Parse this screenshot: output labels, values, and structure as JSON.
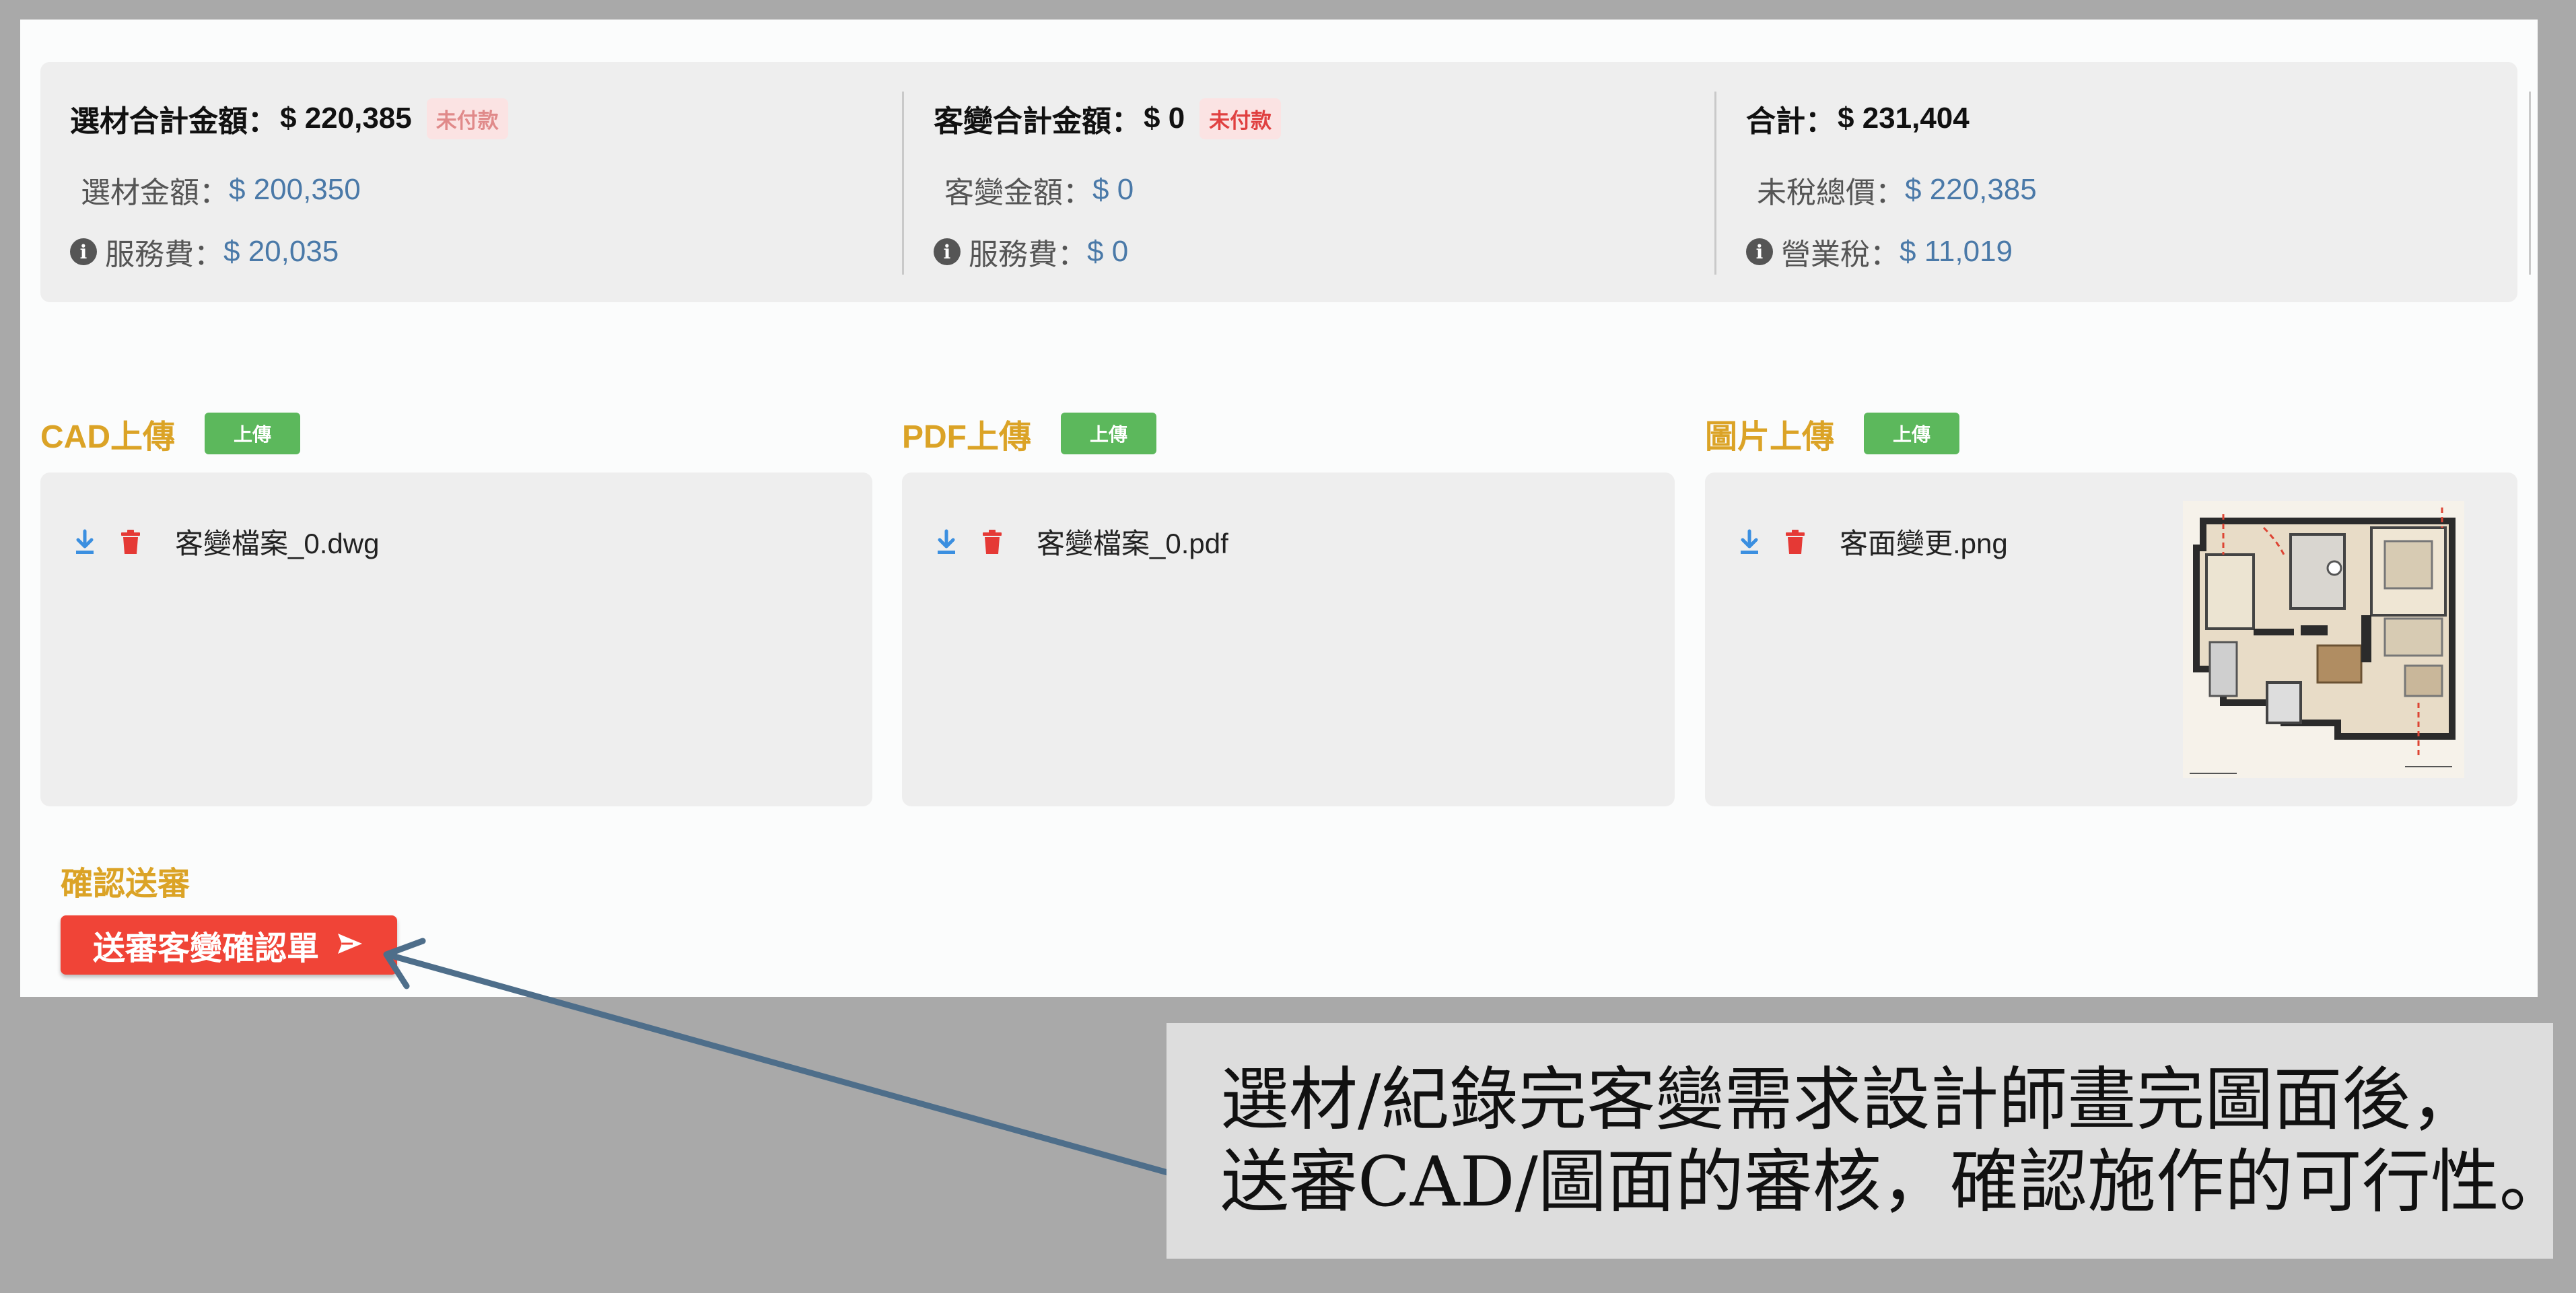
{
  "summary": {
    "materials": {
      "title": "選材合計金額：",
      "total": "$ 220,385",
      "badge": "未付款",
      "row1_label": "選材金額：",
      "row1_value": "$ 200,350",
      "row2_label": "服務費：",
      "row2_value": "$ 20,035"
    },
    "changes": {
      "title": "客變合計金額：",
      "total": "$ 0",
      "badge": "未付款",
      "row1_label": "客變金額：",
      "row1_value": "$ 0",
      "row2_label": "服務費：",
      "row2_value": "$ 0"
    },
    "grand": {
      "title": "合計：",
      "total": "$ 231,404",
      "row1_label": "未稅總價：",
      "row1_value": "$ 220,385",
      "row2_label": "營業稅：",
      "row2_value": "$ 11,019"
    }
  },
  "uploads": {
    "cad": {
      "title": "CAD上傳",
      "button": "上傳",
      "file": "客變檔案_0.dwg"
    },
    "pdf": {
      "title": "PDF上傳",
      "button": "上傳",
      "file": "客變檔案_0.pdf"
    },
    "image": {
      "title": "圖片上傳",
      "button": "上傳",
      "file": "客面變更.png"
    }
  },
  "confirm": {
    "label": "確認送審",
    "button": "送審客變確認單"
  },
  "callout": {
    "line1": "選材/紀錄完客變需求設計師畫完圖面後，",
    "line2": "送審CAD/圖面的審核，確認施作的可行性。"
  },
  "colors": {
    "accent_gold": "#dba326",
    "upload_green": "#5cb85c",
    "danger_red": "#f04437",
    "value_blue": "#4a79a8",
    "arrow": "#4e6e8a"
  },
  "icons": {
    "info": "info-circle-icon",
    "download": "download-icon",
    "delete": "trash-icon",
    "send": "send-icon"
  }
}
